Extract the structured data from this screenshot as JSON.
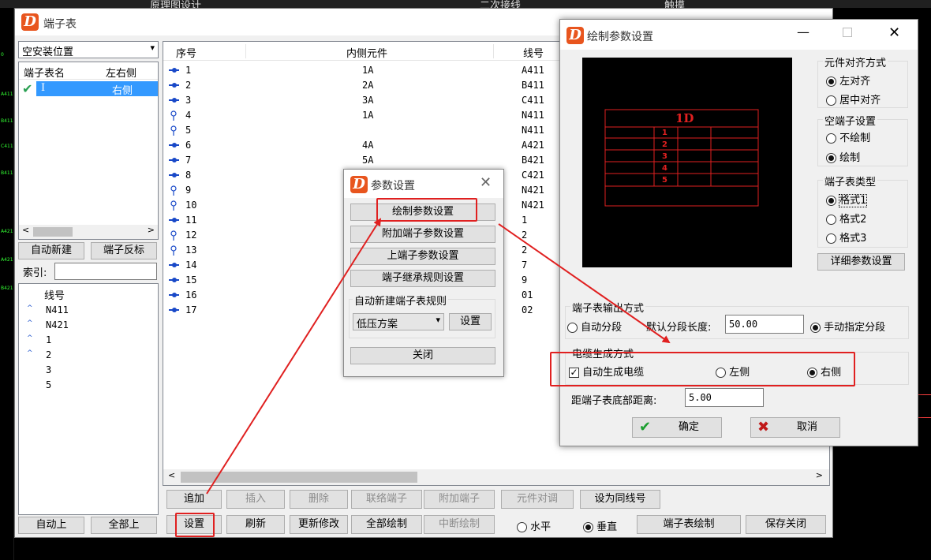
{
  "bg": {
    "tab1": "原理图设计",
    "tab2": "二次接线",
    "tab3": "触摸"
  },
  "cad_ticks": [
    "0",
    "A411",
    "B411",
    "C411",
    "B411",
    "A421",
    "A421",
    "B421"
  ],
  "main": {
    "title": "端子表",
    "location_select": "空安装位置",
    "list_headers": {
      "name": "端子表名",
      "side": "左右侧"
    },
    "list_row": {
      "name": "I",
      "side": "右侧"
    },
    "auto_new": "自动新建",
    "reverse": "端子反标",
    "index_label": "索引:",
    "index_value": "",
    "wire_header": "线号",
    "wire_items": [
      "N411",
      "N421",
      "1",
      "2",
      "3",
      "5"
    ],
    "auto_up": "自动上",
    "all_up": "全部上",
    "table_headers": {
      "seq": "序号",
      "inner": "内侧元件",
      "wire": "线号"
    },
    "rows": [
      {
        "seq": "1",
        "inner": "1A",
        "wire": "A411"
      },
      {
        "seq": "2",
        "inner": "2A",
        "wire": "B411"
      },
      {
        "seq": "3",
        "inner": "3A",
        "wire": "C411"
      },
      {
        "seq": "4",
        "inner": "1A",
        "wire": "N411"
      },
      {
        "seq": "5",
        "inner": "",
        "wire": "N411"
      },
      {
        "seq": "6",
        "inner": "4A",
        "wire": "A421"
      },
      {
        "seq": "7",
        "inner": "5A",
        "wire": "B421"
      },
      {
        "seq": "8",
        "inner": "",
        "wire": "C421"
      },
      {
        "seq": "9",
        "inner": "",
        "wire": "N421"
      },
      {
        "seq": "10",
        "inner": "",
        "wire": "N421"
      },
      {
        "seq": "11",
        "inner": "",
        "wire": "1"
      },
      {
        "seq": "12",
        "inner": "",
        "wire": "2"
      },
      {
        "seq": "13",
        "inner": "",
        "wire": "2"
      },
      {
        "seq": "14",
        "inner": "",
        "wire": "7"
      },
      {
        "seq": "15",
        "inner": "",
        "wire": "9"
      },
      {
        "seq": "16",
        "inner": "",
        "wire": "01"
      },
      {
        "seq": "17",
        "inner": "",
        "wire": "02"
      }
    ],
    "row1_buttons": [
      "追加",
      "插入",
      "删除",
      "联络端子",
      "附加端子",
      "元件对调",
      "设为同线号"
    ],
    "row2_buttons": [
      "设置",
      "刷新",
      "更新修改",
      "全部绘制",
      "中断绘制"
    ],
    "horizontal": "水平",
    "vertical": "垂直",
    "draw_table": "端子表绘制",
    "save_close": "保存关闭"
  },
  "params": {
    "title": "参数设置",
    "buttons": [
      "绘制参数设置",
      "附加端子参数设置",
      "上端子参数设置",
      "端子继承规则设置"
    ],
    "rule_group": "自动新建端子表规则",
    "rule_select": "低压方案",
    "rule_set": "设置",
    "close": "关闭"
  },
  "draw": {
    "title": "绘制参数设置",
    "preview_title": "1D",
    "preview_nums": [
      "1",
      "2",
      "3",
      "4",
      "5"
    ],
    "align_group": "元件对齐方式",
    "align_left": "左对齐",
    "align_center": "居中对齐",
    "empty_group": "空端子设置",
    "empty_no": "不绘制",
    "empty_yes": "绘制",
    "type_group": "端子表类型",
    "type1": "格式1",
    "type2": "格式2",
    "type3": "格式3",
    "detail": "详细参数设置",
    "output_group": "端子表输出方式",
    "auto_seg": "自动分段",
    "seg_len_label": "默认分段长度:",
    "seg_len": "50.00",
    "manual_seg": "手动指定分段",
    "cable_group": "电缆生成方式",
    "auto_cable": "自动生成电缆",
    "left": "左侧",
    "right": "右侧",
    "bottom_label": "距端子表底部距离:",
    "bottom_val": "5.00",
    "ok": "确定",
    "cancel": "取消"
  }
}
